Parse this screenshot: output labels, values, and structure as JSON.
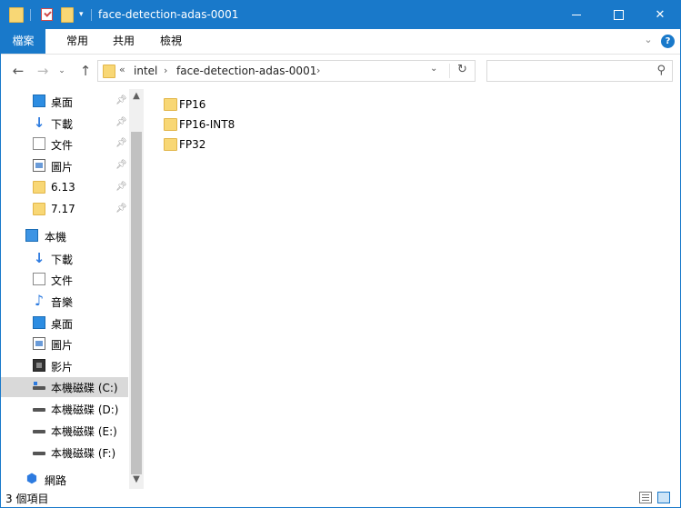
{
  "window": {
    "title": "face-detection-adas-0001",
    "controls": {
      "minimize": "",
      "maximize": "",
      "close": "✕"
    }
  },
  "ribbon": {
    "tabs": [
      {
        "label": "檔案"
      },
      {
        "label": "常用"
      },
      {
        "label": "共用"
      },
      {
        "label": "檢視"
      }
    ],
    "help": "?"
  },
  "navigation": {
    "back": "←",
    "forward": "→",
    "recent": "⌄",
    "up": "↑",
    "address": {
      "overflow": "«",
      "breadcrumb": [
        "intel",
        "face-detection-adas-0001"
      ],
      "sep": "›"
    },
    "refresh": "↻",
    "search": {
      "placeholder": ""
    }
  },
  "sidebar": {
    "quick_access": [
      {
        "label": "桌面",
        "icon": "desktop-icon",
        "pinned": true
      },
      {
        "label": "下載",
        "icon": "download-icon",
        "pinned": true
      },
      {
        "label": "文件",
        "icon": "documents-icon",
        "pinned": true
      },
      {
        "label": "圖片",
        "icon": "pictures-icon",
        "pinned": true
      },
      {
        "label": "6.13",
        "icon": "folder-icon",
        "pinned": true
      },
      {
        "label": "7.17",
        "icon": "folder-icon",
        "pinned": true
      }
    ],
    "this_pc": {
      "label": "本機",
      "items": [
        {
          "label": "下載",
          "icon": "download-icon"
        },
        {
          "label": "文件",
          "icon": "documents-icon"
        },
        {
          "label": "音樂",
          "icon": "music-icon"
        },
        {
          "label": "桌面",
          "icon": "desktop-icon"
        },
        {
          "label": "圖片",
          "icon": "pictures-icon"
        },
        {
          "label": "影片",
          "icon": "videos-icon"
        },
        {
          "label": "本機磁碟 (C:)",
          "icon": "drive-c-icon",
          "selected": true
        },
        {
          "label": "本機磁碟 (D:)",
          "icon": "drive-icon"
        },
        {
          "label": "本機磁碟 (E:)",
          "icon": "drive-icon"
        },
        {
          "label": "本機磁碟 (F:)",
          "icon": "drive-icon"
        }
      ]
    },
    "network": {
      "label": "網路",
      "icon": "network-icon"
    }
  },
  "content": {
    "items": [
      {
        "label": "FP16",
        "type": "folder"
      },
      {
        "label": "FP16-INT8",
        "type": "folder"
      },
      {
        "label": "FP32",
        "type": "folder"
      }
    ]
  },
  "status": {
    "item_count": "3 個項目"
  },
  "colors": {
    "accent": "#1979ca",
    "folder": "#f8d775",
    "selected": "#d9d9d9"
  }
}
